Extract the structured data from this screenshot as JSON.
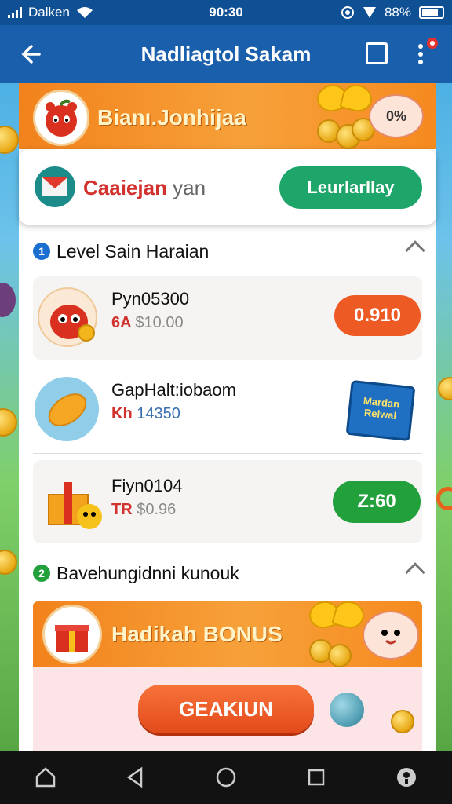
{
  "status_bar": {
    "carrier": "Dalken",
    "time": "90:30",
    "battery": "88%"
  },
  "app_bar": {
    "title": "Nadliagtol Sakam"
  },
  "top_banner": {
    "title": "Bianı.Jonhijaa",
    "badge": "0%"
  },
  "promo_card": {
    "label_red": "Caaiejan",
    "label_gray": " yan",
    "button": "Leurlarllay"
  },
  "section1": {
    "number": "1",
    "title": "Level Sain Haraian"
  },
  "items": [
    {
      "name": "Pyn05300",
      "sub_red": "6A ",
      "sub_gray": "$10.00",
      "button": "0.910",
      "button_color": "#ee5a24"
    },
    {
      "name": "GapHalt:iobaom",
      "sub_red": "Kh ",
      "sub_gray": "14350",
      "bag_label": "Mardan Relwal"
    },
    {
      "name": "Fiyn0104",
      "sub_red": "TR ",
      "sub_gray": "$0.96",
      "button": "Z:60",
      "button_color": "#22a03c"
    }
  ],
  "section2": {
    "number": "2",
    "title": "Bavehungidnni kunouk"
  },
  "bonus_banner": {
    "title": "Hadikah BONUS",
    "button": "GEAKIUN"
  },
  "colors": {
    "primary": "#1a5fab",
    "status": "#0f4f93",
    "orange": "#f2821c",
    "green_button": "#1ea66a",
    "red_button": "#ee5a24"
  }
}
